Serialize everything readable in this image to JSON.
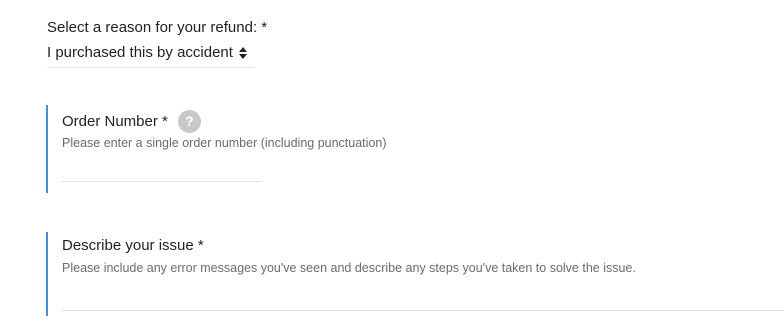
{
  "reason": {
    "label": "Select a reason for your refund: *",
    "selected": "I purchased this by accident",
    "icon": "sort-arrows-icon"
  },
  "order_number": {
    "label": "Order Number *",
    "help_icon": "?",
    "hint": "Please enter a single order number (including punctuation)",
    "value": ""
  },
  "issue": {
    "label": "Describe your issue *",
    "hint": "Please include any error messages you've seen and describe any steps you've taken to solve the issue.",
    "value": ""
  },
  "colors": {
    "accent": "#4a8bd8",
    "help_icon_bg": "#c8c8c8",
    "hint_text": "#6b6b6b"
  }
}
